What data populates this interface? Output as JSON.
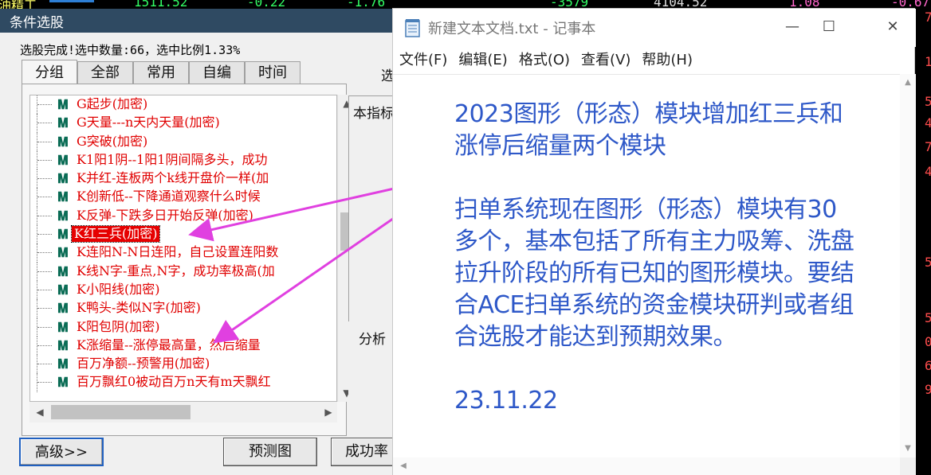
{
  "background_app": {
    "ticker_fragments": [
      "油精工",
      "1511.52",
      "-0.22",
      "-1.76",
      "-3579",
      "4104.52",
      "1.08",
      "-0.67"
    ],
    "right_edge_digits": [
      "7",
      "1",
      "5",
      "4",
      "7",
      "4",
      "5",
      "5",
      "0",
      "6",
      "9"
    ]
  },
  "dialog": {
    "title": "条件选股",
    "status": "选股完成!选中数量:66，选中比例1.33%",
    "tabs": [
      "分组",
      "全部",
      "常用",
      "自编",
      "时间"
    ],
    "tree_items": [
      "G起步(加密)",
      "G天量---n天内天量(加密)",
      "G突破(加密)",
      "K1阳1阴--1阳1阴间隔多头，成功",
      "K并红-连板两个k线开盘价一样(加",
      "K创新低--下降通道观察什么时候",
      "K反弹-下跌多日开始反弹(加密)",
      "K红三兵(加密)",
      "K连阳N-N日连阳，自己设置连阳数",
      "K线N字-重点,N字，成功率极高(加",
      "K小阳线(加密)",
      "K鸭头-类似N字(加密)",
      "K阳包阴(加密)",
      "K涨缩量--涨停最高量，然后缩量",
      "百万净额--预警用(加密)",
      "百万飘红0被动百万n天有m天飘红"
    ],
    "selected_index": 7,
    "side_labels": {
      "top_cut": "选",
      "panel_text": "本指标",
      "analysis": "分析"
    },
    "buttons": {
      "advanced": "高级>>",
      "forecast": "预测图",
      "success_rate": "成功率"
    }
  },
  "notepad": {
    "title": "新建文本文档.txt - 记事本",
    "menu": [
      "文件(F)",
      "编辑(E)",
      "格式(O)",
      "查看(V)",
      "帮助(H)"
    ],
    "lines": [
      "2023图形（形态）模块增加红三兵和",
      "涨停后缩量两个模块",
      "",
      "扫单系统现在图形（形态）模块有30",
      "多个，基本包括了所有主力吸筹、洗盘",
      "拉升阶段的所有已知的图形模块。要结",
      "合ACE扫单系统的资金模块研判或者组",
      "合选股才能达到预期效果。",
      "",
      "23.11.22"
    ]
  },
  "colors": {
    "tree_text": "#e00000",
    "selection_bg": "#e60000",
    "annotation_arrow": "#e040e0",
    "notepad_text": "#2e58c8"
  }
}
